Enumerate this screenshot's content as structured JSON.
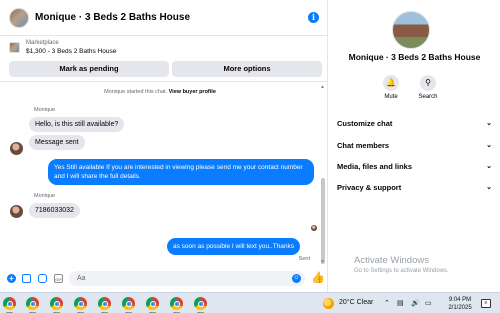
{
  "chat": {
    "title": "Monique · 3 Beds 2 Baths House",
    "info_icon": "i",
    "listing": {
      "source": "Marketplace",
      "detail": "$1,300 - 3 Beds 2 Baths House",
      "mark_pending_label": "Mark as pending",
      "more_options_label": "More options"
    },
    "started_text": "Monique started this chat.",
    "view_profile_label": "View buyer profile",
    "messages": [
      {
        "sender": "Monique",
        "text": "Hello, is this still available?"
      },
      {
        "text": "Message sent"
      },
      {
        "text": "Yes Still available If you are interested in viewing please send me your contact number and I will share the full details."
      },
      {
        "sender": "Monique",
        "text": "7186033032"
      },
      {
        "text": "as soon as possible I will text you..Thanks"
      }
    ],
    "sent_status": "Sent",
    "composer": {
      "placeholder": "Aa",
      "gif_label": "GIF"
    }
  },
  "details": {
    "title": "Monique · 3 Beds 2 Baths House",
    "actions": [
      {
        "label": "Mute",
        "icon": "bell-icon"
      },
      {
        "label": "Search",
        "icon": "search-icon"
      }
    ],
    "sections": [
      {
        "label": "Customize chat"
      },
      {
        "label": "Chat members"
      },
      {
        "label": "Media, files and links"
      },
      {
        "label": "Privacy & support"
      }
    ]
  },
  "watermark": {
    "title": "Activate Windows",
    "subtitle": "Go to Settings to activate Windows."
  },
  "taskbar": {
    "app_icon": "chrome-icon",
    "app_count": 9,
    "weather": "20°C  Clear",
    "time": "9:04 PM",
    "date": "2/1/2025"
  },
  "colors": {
    "accent": "#0a7cff",
    "bubble_in": "#e4e6eb",
    "taskbar": "#dfe6ef"
  }
}
